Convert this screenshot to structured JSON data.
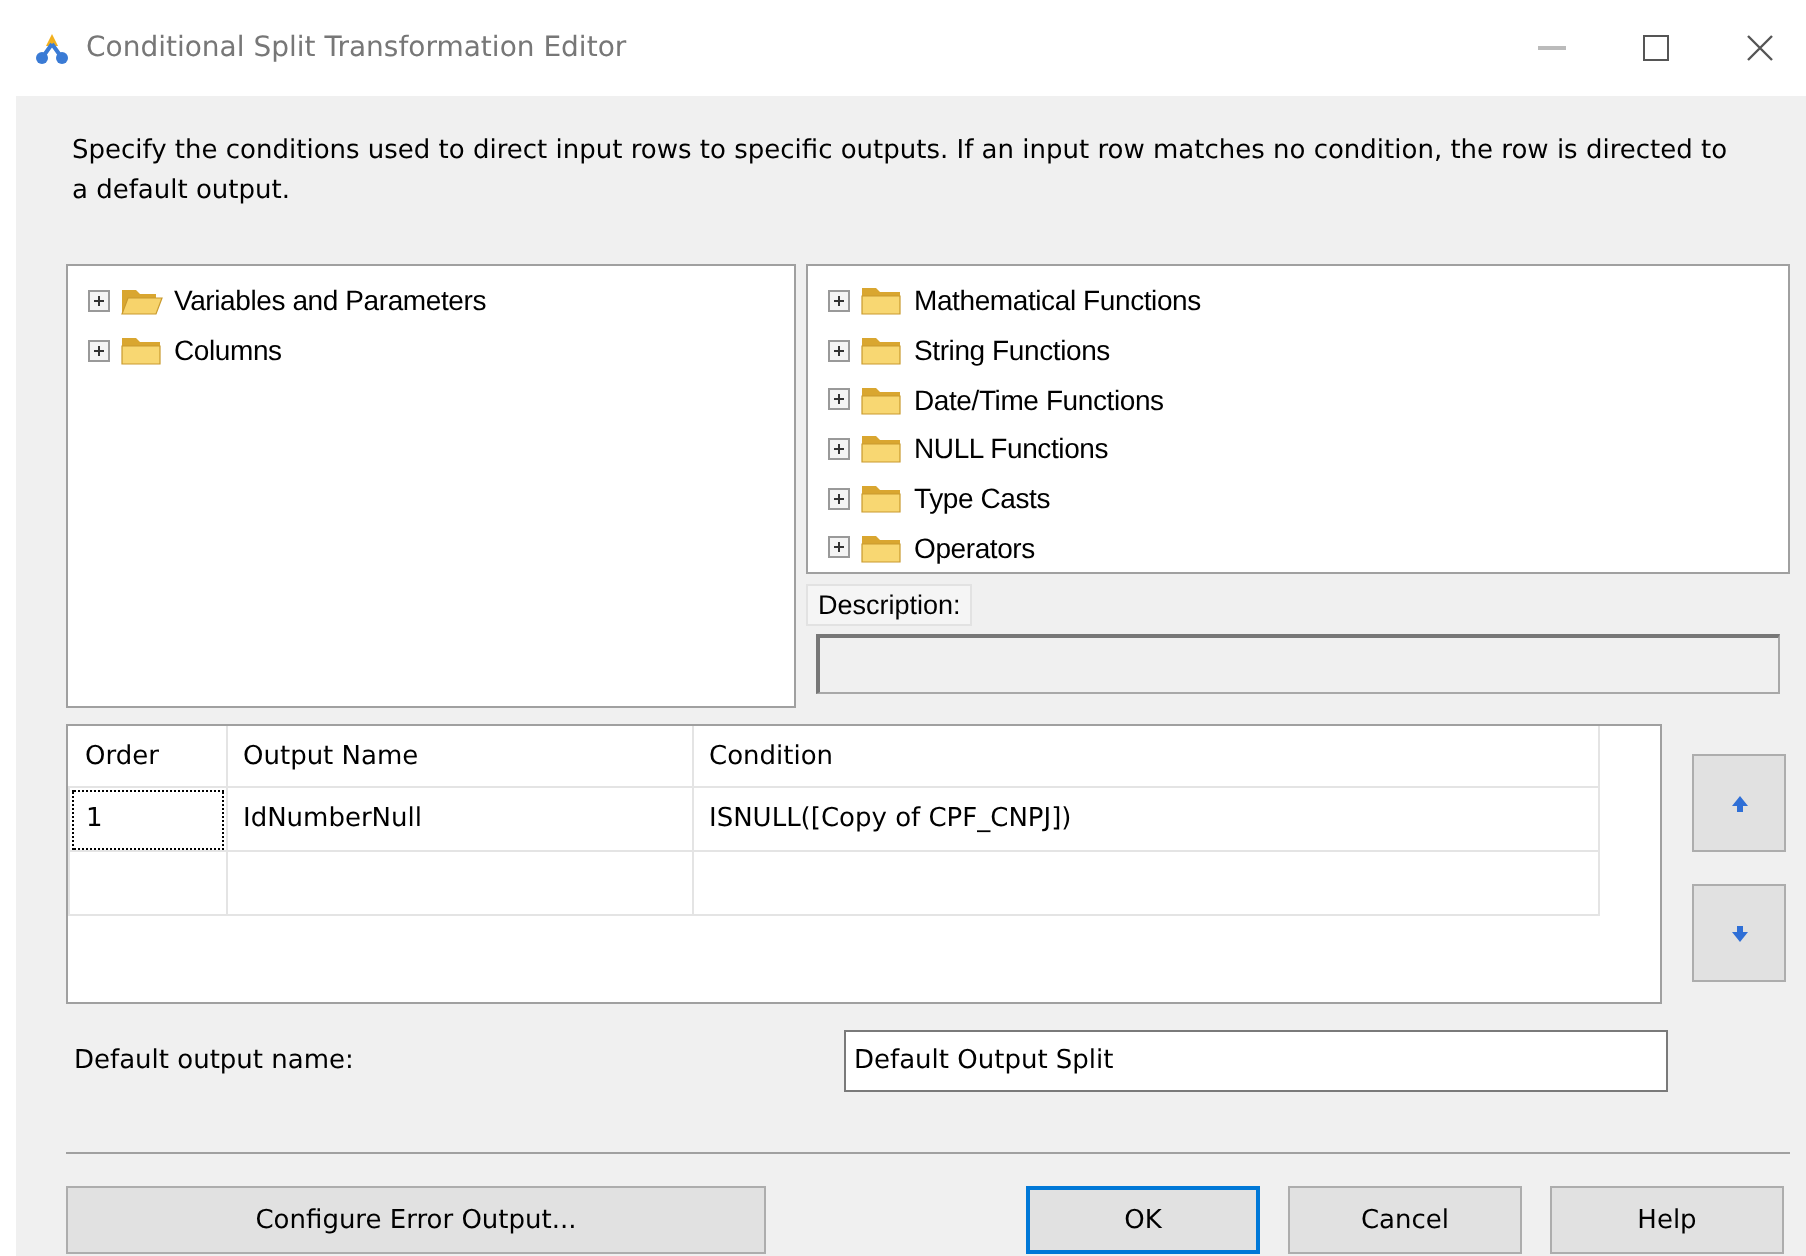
{
  "window": {
    "title": "Conditional Split Transformation Editor"
  },
  "instructions": "Specify the conditions used to direct input rows to specific outputs. If an input row matches no condition, the row is directed to a default output.",
  "input_tree": [
    {
      "label": "Variables and Parameters",
      "expanded": false,
      "kind": "open-folder"
    },
    {
      "label": "Columns",
      "expanded": false,
      "kind": "folder"
    }
  ],
  "function_tree": [
    {
      "label": "Mathematical Functions",
      "expanded": false,
      "kind": "folder"
    },
    {
      "label": "String Functions",
      "expanded": false,
      "kind": "folder"
    },
    {
      "label": "Date/Time Functions",
      "expanded": false,
      "kind": "folder"
    },
    {
      "label": "NULL Functions",
      "expanded": false,
      "kind": "folder"
    },
    {
      "label": "Type Casts",
      "expanded": false,
      "kind": "folder"
    },
    {
      "label": "Operators",
      "expanded": false,
      "kind": "folder"
    }
  ],
  "description": {
    "label": "Description:"
  },
  "conditions_table": {
    "columns": [
      "Order",
      "Output Name",
      "Condition"
    ],
    "rows": [
      {
        "cells": [
          "1",
          "IdNumberNull",
          "ISNULL([Copy of CPF_CNPJ])"
        ],
        "focused": true
      }
    ]
  },
  "default_output": {
    "label": "Default output name:",
    "value": "Default Output Split"
  },
  "buttons": [
    {
      "label": "Configure Error Output...",
      "default": false,
      "kind": "left"
    },
    {
      "label": "OK",
      "default": true,
      "kind": "right"
    },
    {
      "label": "Cancel",
      "default": false,
      "kind": "right"
    },
    {
      "label": "Help",
      "default": false,
      "kind": "right"
    }
  ]
}
